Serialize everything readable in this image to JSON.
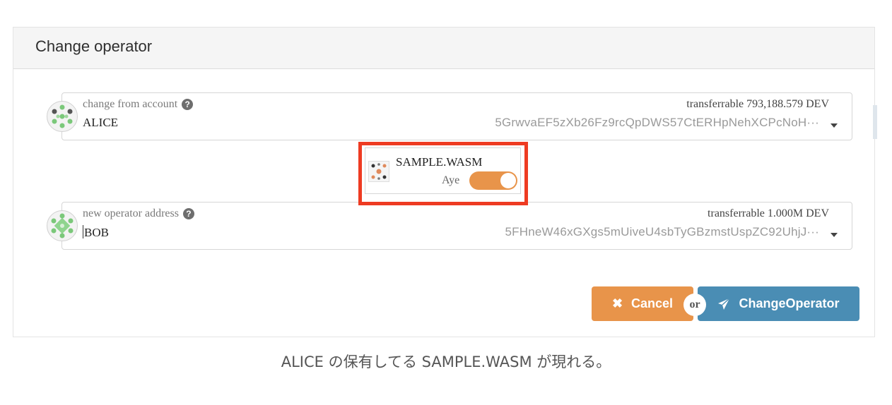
{
  "dialog": {
    "title": "Change operator"
  },
  "from_account": {
    "label": "change from account",
    "help_icon": "question-circle-icon",
    "value": "ALICE",
    "balance": "transferrable 793,188.579 DEV",
    "address": "5GrwvaEF5zXb26Fz9rcQpDWS57CtERHpNehXCPcNoH···",
    "avatar_icon": "identicon-icon"
  },
  "token": {
    "name": "SAMPLE.WASM",
    "toggle_label": "Aye",
    "toggle_on": true,
    "icon": "identicon-icon"
  },
  "new_operator": {
    "label": "new operator address",
    "help_icon": "question-circle-icon",
    "value": "BOB",
    "balance": "transferrable 1.000M DEV",
    "address": "5FHneW46xGXgs5mUiveU4sbTyGBzmstUspZC92UhjJ···",
    "avatar_icon": "identicon-icon"
  },
  "actions": {
    "cancel_label": "Cancel",
    "cancel_icon": "close-icon",
    "or_label": "or",
    "submit_label": "ChangeOperator",
    "submit_icon": "send-icon"
  },
  "caption": "ALICE の保有してる SAMPLE.WASM が現れる。",
  "colors": {
    "accent_orange": "#e8944a",
    "accent_blue": "#4a8db4",
    "highlight_red": "#ee3b22"
  }
}
